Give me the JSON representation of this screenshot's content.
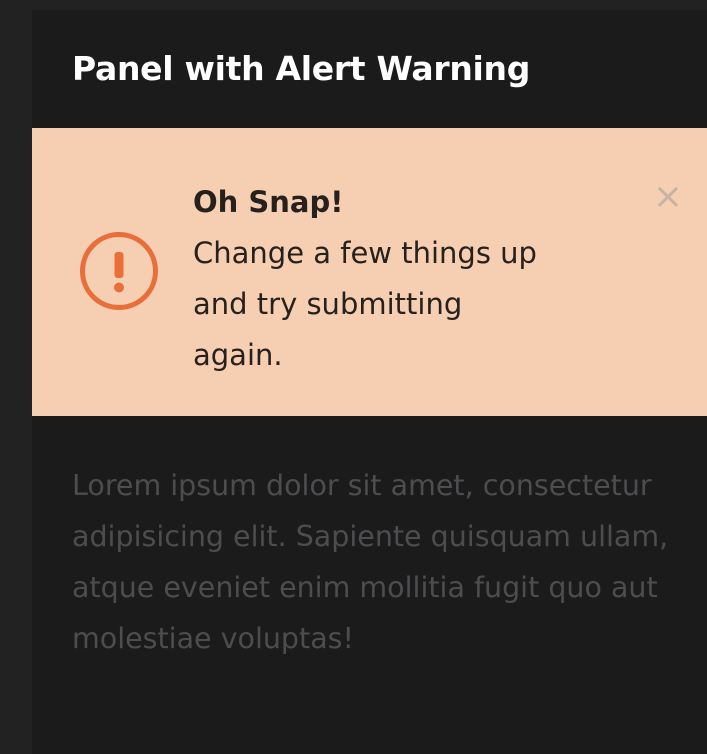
{
  "panel": {
    "title": "Panel with Alert Warning",
    "body_text": "Lorem ipsum dolor sit amet, consectetur adipisicing elit. Sapiente quisquam ullam, atque eveniet enim mollitia fugit quo aut molestiae voluptas!"
  },
  "alert": {
    "heading": "Oh Snap!",
    "message": "Change a few things up and try submitting again.",
    "icon": "exclamation-circle-icon",
    "close_icon": "close-icon",
    "close_glyph": "×",
    "background_color": "#f6cfb3",
    "icon_color": "#e96f3a"
  }
}
